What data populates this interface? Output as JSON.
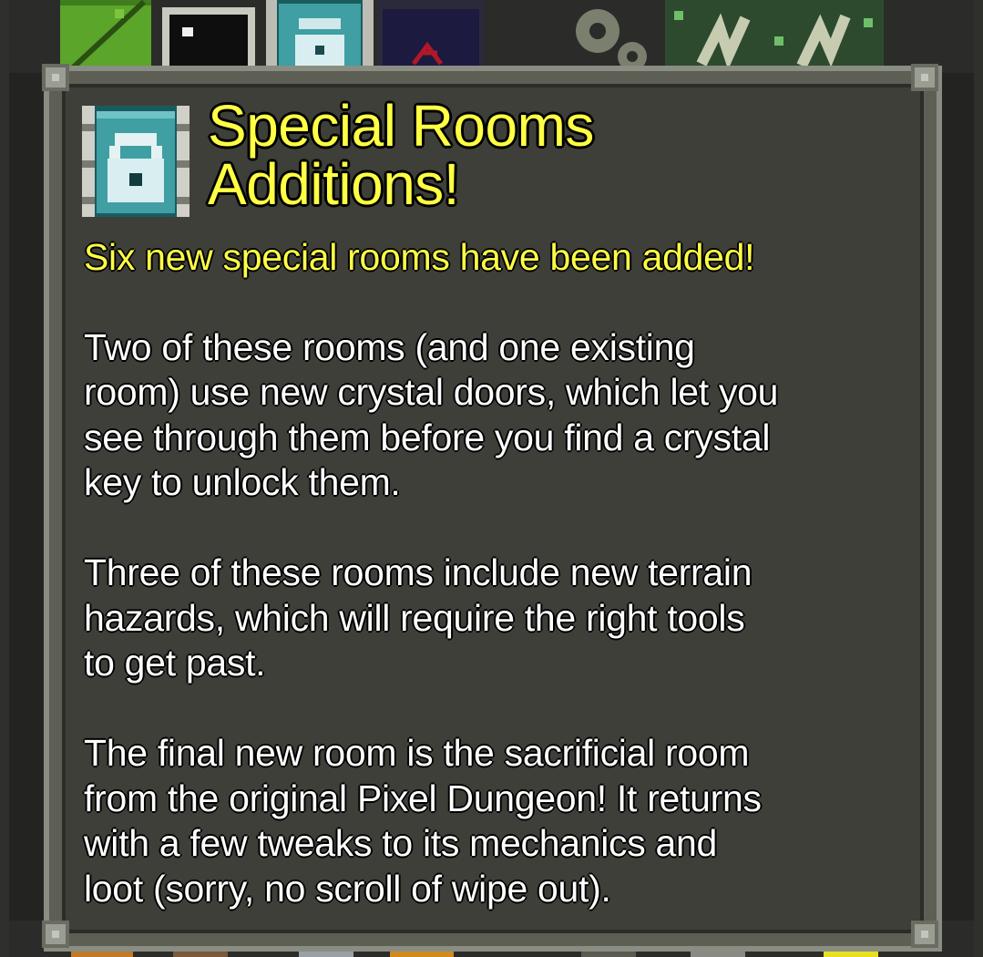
{
  "dialog": {
    "title": "Special Rooms\nAdditions!",
    "subtitle": "Six new special rooms have been added!",
    "paragraphs": [
      "Two of these rooms (and one existing\nroom) use new crystal doors, which let you\nsee through them before you find a crystal\nkey to unlock them.",
      "Three of these rooms include new terrain\nhazards, which will require the right tools\nto get past.",
      "The final new room is the sacrificial room\nfrom the original Pixel Dungeon! It returns\nwith a few tweaks to its mechanics and\nloot (sorry, no scroll of wipe out)."
    ],
    "icon": "crystal-door-icon"
  },
  "background_icons": [
    "grass-tile-icon",
    "sign-icon",
    "crystal-door-icon",
    "sacrificial-altar-icon",
    "gear-icon",
    "herb-icon"
  ],
  "colors": {
    "title": "#ffff44",
    "text": "#ffffff",
    "window_frame": "#8a8d82",
    "window_fill": "#3e3f39"
  }
}
